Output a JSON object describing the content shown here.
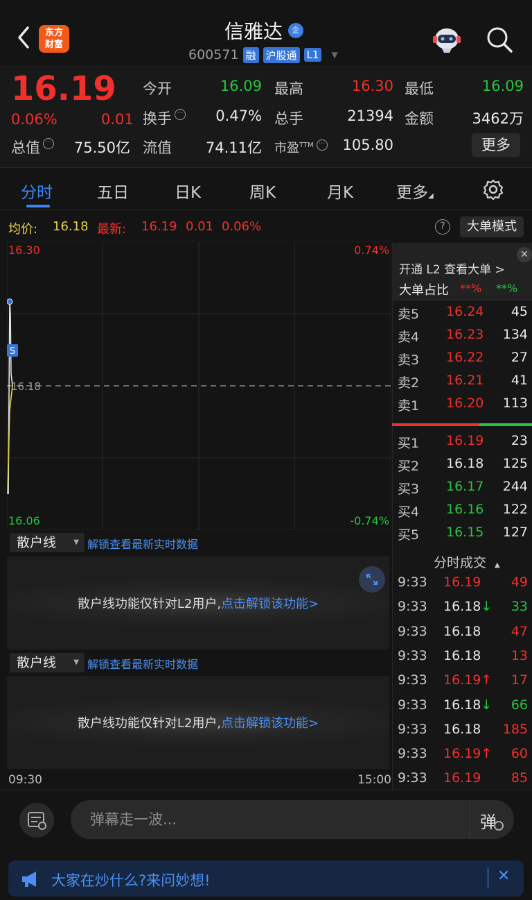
{
  "header": {
    "logo_line1": "东方",
    "logo_line2": "财富",
    "stock_name": "信雅达",
    "badge": "企",
    "code": "600571",
    "tags": [
      "融",
      "沪股通",
      "L1"
    ]
  },
  "quote": {
    "price": "16.19",
    "change_pct": "0.06%",
    "change_amt": "0.01",
    "total_value_label": "总值",
    "total_value": "75.50亿",
    "fields": {
      "open_label": "今开",
      "open": "16.09",
      "high_label": "最高",
      "high": "16.30",
      "low_label": "最低",
      "low": "16.09",
      "turnover_label": "换手",
      "turnover": "0.47%",
      "volume_label": "总手",
      "volume": "21394",
      "amount_label": "金额",
      "amount": "3462万",
      "float_label": "流值",
      "float": "74.11亿",
      "pe_label": "市盈",
      "pe_sup": "TTM",
      "pe": "105.80"
    },
    "more_label": "更多"
  },
  "tabs": [
    "分时",
    "五日",
    "日K",
    "周K",
    "月K",
    "更多"
  ],
  "avg": {
    "avg_label": "均价:",
    "avg_value": "16.18",
    "latest_label": "最新:",
    "latest_price": "16.19",
    "latest_change": "0.01",
    "latest_pct": "0.06%",
    "help": "?",
    "big_order_label": "大单模式"
  },
  "chart_data": {
    "type": "line",
    "y_top": "16.30",
    "y_bottom": "16.06",
    "pct_top": "0.74%",
    "pct_bottom": "-0.74%",
    "avg_price_label": "16.18",
    "ylim": [
      16.06,
      16.3
    ],
    "x_start": "09:30",
    "x_end": "15:00",
    "series": [
      {
        "values": [
          16.09,
          16.25,
          16.24,
          16.19,
          16.18
        ]
      },
      {
        "values": [
          16.09,
          16.16,
          16.18
        ]
      }
    ],
    "markers": [
      "S"
    ]
  },
  "retail": [
    {
      "select": "散户线",
      "unlock": "解锁查看最新实时数据",
      "msg": "散户线功能仅针对L2用户,",
      "msg_link": "点击解锁该功能>"
    },
    {
      "select": "散户线",
      "unlock": "解锁查看最新实时数据",
      "msg": "散户线功能仅针对L2用户,",
      "msg_link": "点击解锁该功能>"
    }
  ],
  "l2": {
    "open_text": "开通 L2 查看大单 >",
    "ratio_label": "大单占比",
    "ratio_red": "**%",
    "ratio_green": "**%"
  },
  "asks": [
    {
      "label": "卖5",
      "price": "16.24",
      "vol": "45",
      "color": "red"
    },
    {
      "label": "卖4",
      "price": "16.23",
      "vol": "134",
      "color": "red"
    },
    {
      "label": "卖3",
      "price": "16.22",
      "vol": "27",
      "color": "red"
    },
    {
      "label": "卖2",
      "price": "16.21",
      "vol": "41",
      "color": "red"
    },
    {
      "label": "卖1",
      "price": "16.20",
      "vol": "113",
      "color": "red"
    }
  ],
  "bids": [
    {
      "label": "买1",
      "price": "16.19",
      "vol": "23",
      "color": "red"
    },
    {
      "label": "买2",
      "price": "16.18",
      "vol": "125",
      "color": "white"
    },
    {
      "label": "买3",
      "price": "16.17",
      "vol": "244",
      "color": "green"
    },
    {
      "label": "买4",
      "price": "16.16",
      "vol": "122",
      "color": "green"
    },
    {
      "label": "买5",
      "price": "16.15",
      "vol": "127",
      "color": "green"
    }
  ],
  "ticks_title": "分时成交",
  "ticks": [
    {
      "time": "9:33",
      "price": "16.19",
      "arrow": "",
      "vol": "49",
      "pcolor": "red",
      "vcolor": "red"
    },
    {
      "time": "9:33",
      "price": "16.18",
      "arrow": "↓",
      "vol": "33",
      "pcolor": "white",
      "vcolor": "green"
    },
    {
      "time": "9:33",
      "price": "16.18",
      "arrow": "",
      "vol": "47",
      "pcolor": "white",
      "vcolor": "red"
    },
    {
      "time": "9:33",
      "price": "16.18",
      "arrow": "",
      "vol": "13",
      "pcolor": "white",
      "vcolor": "red"
    },
    {
      "time": "9:33",
      "price": "16.19",
      "arrow": "↑",
      "vol": "17",
      "pcolor": "red",
      "vcolor": "red"
    },
    {
      "time": "9:33",
      "price": "16.18",
      "arrow": "↓",
      "vol": "66",
      "pcolor": "white",
      "vcolor": "green"
    },
    {
      "time": "9:33",
      "price": "16.18",
      "arrow": "",
      "vol": "185",
      "pcolor": "white",
      "vcolor": "red"
    },
    {
      "time": "9:33",
      "price": "16.19",
      "arrow": "↑",
      "vol": "60",
      "pcolor": "red",
      "vcolor": "red"
    },
    {
      "time": "9:33",
      "price": "16.19",
      "arrow": "",
      "vol": "85",
      "pcolor": "red",
      "vcolor": "red"
    }
  ],
  "bottom": {
    "danmu_placeholder": "弹幕走一波...",
    "danmu_toggle": "弹",
    "ask_text": "大家在炒什么?来问妙想!"
  },
  "colors": {
    "up": "#f0302c",
    "down": "#27c43f",
    "accent": "#3d86f5",
    "background": "#141414"
  }
}
